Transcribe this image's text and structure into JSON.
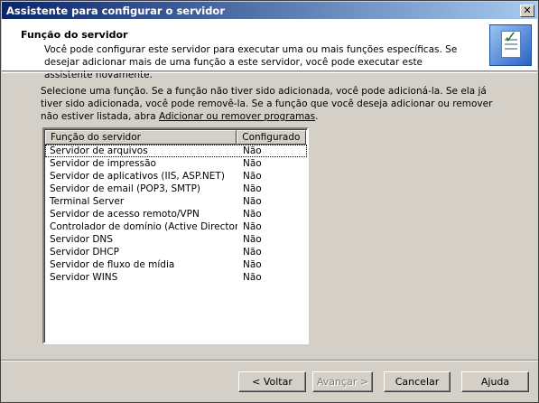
{
  "window": {
    "title": "Assistente para configurar o servidor",
    "close_glyph": "✕"
  },
  "header": {
    "title": "Função do servidor",
    "description": "Você pode configurar este servidor para executar uma ou mais funções específicas. Se desejar adicionar mais de uma função a este servidor, você pode executar este assistente novamente.",
    "icon": "wizard-checklist-icon"
  },
  "intro": {
    "text": "Selecione uma função. Se a função não tiver sido adicionada, você pode adicioná-la. Se ela já tiver sido adicionada, você pode removê-la. Se a função que você deseja adicionar ou remover não estiver listada, abra ",
    "link": "Adicionar ou remover programas",
    "suffix": "."
  },
  "table": {
    "columns": [
      "Função do servidor",
      "Configurado"
    ],
    "rows": [
      [
        "Servidor de arquivos",
        "Não"
      ],
      [
        "Servidor de impressão",
        "Não"
      ],
      [
        "Servidor de aplicativos (IIS, ASP.NET)",
        "Não"
      ],
      [
        "Servidor de email (POP3, SMTP)",
        "Não"
      ],
      [
        "Terminal Server",
        "Não"
      ],
      [
        "Servidor de acesso remoto/VPN",
        "Não"
      ],
      [
        "Controlador de domínio (Active Directory)",
        "Não"
      ],
      [
        "Servidor DNS",
        "Não"
      ],
      [
        "Servidor DHCP",
        "Não"
      ],
      [
        "Servidor de fluxo de mídia",
        "Não"
      ],
      [
        "Servidor WINS",
        "Não"
      ]
    ]
  },
  "buttons": {
    "back": "< Voltar",
    "next": "Avançar >",
    "cancel": "Cancelar",
    "help": "Ajuda"
  }
}
